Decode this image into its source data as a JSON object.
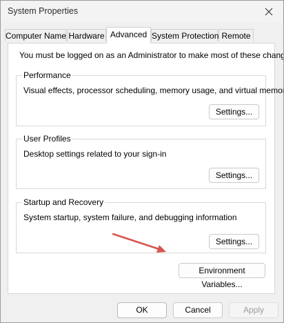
{
  "window": {
    "title": "System Properties"
  },
  "tabs": [
    {
      "label": "Computer Name"
    },
    {
      "label": "Hardware"
    },
    {
      "label": "Advanced",
      "active": true
    },
    {
      "label": "System Protection"
    },
    {
      "label": "Remote"
    }
  ],
  "notice": "You must be logged on as an Administrator to make most of these changes.",
  "groups": {
    "performance": {
      "title": "Performance",
      "description": "Visual effects, processor scheduling, memory usage, and virtual memory",
      "button": "Settings..."
    },
    "user_profiles": {
      "title": "User Profiles",
      "description": "Desktop settings related to your sign-in",
      "button": "Settings..."
    },
    "startup_recovery": {
      "title": "Startup and Recovery",
      "description": "System startup, system failure, and debugging information",
      "button": "Settings..."
    }
  },
  "environment_button": "Environment Variables...",
  "footer": {
    "ok": "OK",
    "cancel": "Cancel",
    "apply": "Apply"
  },
  "annotation": {
    "arrow_color": "#d9534f"
  },
  "icons": {
    "close": "close-icon",
    "arrow": "arrow-annotation-icon"
  }
}
